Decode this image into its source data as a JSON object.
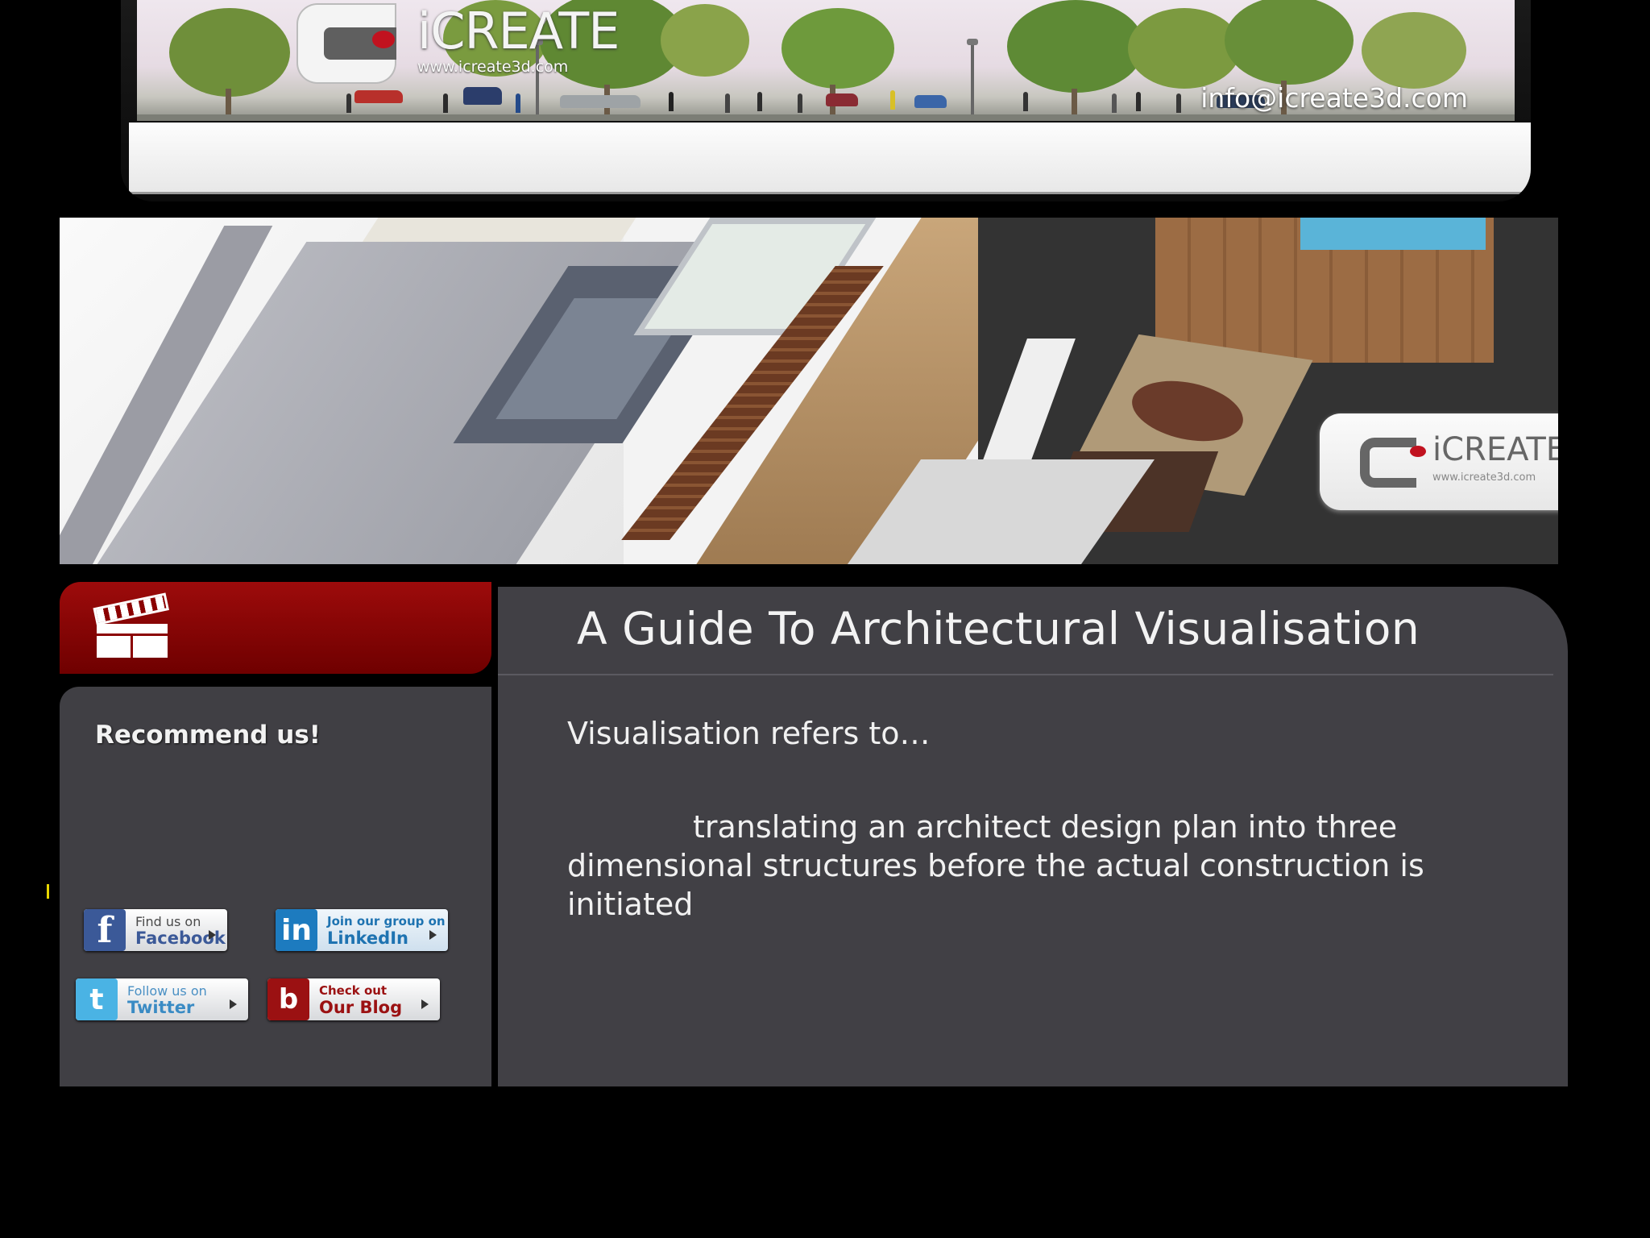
{
  "header": {
    "logo_text": "iCREATE",
    "logo_url": "www.icreate3d.com",
    "email": "info@icreate3d.com"
  },
  "banner": {
    "logo_text": "iCREATE",
    "logo_url": "www.icreate3d.com"
  },
  "sidebar": {
    "recommend_title": "Recommend us!",
    "social": [
      {
        "small": "Find us on",
        "big": "Facebook",
        "icon": "facebook-icon",
        "color": "#3b5998"
      },
      {
        "small": "Join our group on",
        "big": "LinkedIn",
        "icon": "linkedin-icon",
        "color": "#1d7bbf"
      },
      {
        "small": "Follow us on",
        "big": "Twitter",
        "icon": "twitter-icon",
        "color": "#4ab3e4"
      },
      {
        "small": "Check out",
        "big": "Our Blog",
        "icon": "blog-icon",
        "color": "#9b1112"
      }
    ]
  },
  "main": {
    "title": "A Guide To Architectural Visualisation",
    "intro": "Visualisation refers to…",
    "body": "translating an architect design plan into three dimensional structures before  the actual construction is initiated"
  },
  "colors": {
    "accent_red": "#8b0000",
    "panel": "#414045",
    "background": "#000000"
  }
}
